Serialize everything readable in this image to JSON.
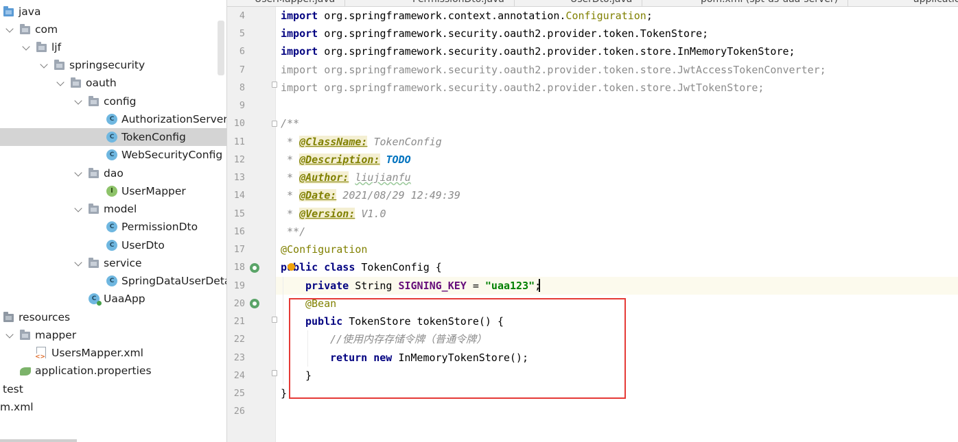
{
  "tabs": [
    "UserMapper.java",
    "PermissionDto.java",
    "UserDto.java",
    "pom.xml (spt-ds-uaa-server)",
    "application"
  ],
  "tree": [
    {
      "label": "java",
      "icon": "folder-blue-icon",
      "depth": 0
    },
    {
      "label": "com",
      "icon": "package-icon",
      "depth": 1
    },
    {
      "label": "ljf",
      "icon": "package-icon",
      "depth": 2
    },
    {
      "label": "springsecurity",
      "icon": "package-icon",
      "depth": 3
    },
    {
      "label": "oauth",
      "icon": "package-icon",
      "depth": 4
    },
    {
      "label": "config",
      "icon": "package-icon",
      "depth": 5
    },
    {
      "label": "AuthorizationServer",
      "icon": "class-icon",
      "depth": 6
    },
    {
      "label": "TokenConfig",
      "icon": "class-icon",
      "depth": 6,
      "selected": true
    },
    {
      "label": "WebSecurityConfig",
      "icon": "class-icon",
      "depth": 6
    },
    {
      "label": "dao",
      "icon": "package-icon",
      "depth": 5
    },
    {
      "label": "UserMapper",
      "icon": "interface-icon",
      "depth": 6
    },
    {
      "label": "model",
      "icon": "package-icon",
      "depth": 5
    },
    {
      "label": "PermissionDto",
      "icon": "class-icon",
      "depth": 6
    },
    {
      "label": "UserDto",
      "icon": "class-icon",
      "depth": 6
    },
    {
      "label": "service",
      "icon": "package-icon",
      "depth": 5
    },
    {
      "label": "SpringDataUserDetai",
      "icon": "class-icon",
      "depth": 6
    },
    {
      "label": "UaaApp",
      "icon": "spring-app-icon",
      "depth": 5
    },
    {
      "label": "resources",
      "icon": "resources-folder-icon",
      "depth": 0
    },
    {
      "label": "mapper",
      "icon": "package-icon",
      "depth": 1
    },
    {
      "label": "UsersMapper.xml",
      "icon": "xml-file-icon",
      "depth": 2
    },
    {
      "label": "application.properties",
      "icon": "spring-properties-icon",
      "depth": 1
    },
    {
      "label": "test",
      "icon": "none",
      "depth": 0
    },
    {
      "label": "m.xml",
      "icon": "none",
      "depth": 0
    }
  ],
  "editor": {
    "line_numbers": [
      "4",
      "5",
      "6",
      "7",
      "8",
      "9",
      "10",
      "11",
      "12",
      "13",
      "14",
      "15",
      "16",
      "17",
      "18",
      "19",
      "20",
      "21",
      "22",
      "23",
      "24",
      "25",
      "26"
    ],
    "import4_kw": "import",
    "import4_pkg": " org.springframework.context.annotation.",
    "import4_cls": "Configuration",
    "import4_end": ";",
    "import5_kw": "import",
    "import5_rest": " org.springframework.security.oauth2.provider.token.TokenStore;",
    "import6_kw": "import",
    "import6_rest": " org.springframework.security.oauth2.provider.token.store.InMemoryTokenStore;",
    "import7": "import org.springframework.security.oauth2.provider.token.store.JwtAccessTokenConverter;",
    "import8": "import org.springframework.security.oauth2.provider.token.store.JwtTokenStore;",
    "doc_open": "/**",
    "doc_star": " * ",
    "doc_close": " **/",
    "tag_classname": "@ClassName:",
    "val_classname": " TokenConfig",
    "tag_description": "@Description:",
    "val_description": "TODO",
    "tag_author": "@Author:",
    "val_author": "liujianfu",
    "tag_date": "@Date:",
    "val_date": " 2021/08/29 12:49:39",
    "tag_version": "@Version:",
    "val_version": " V1.0",
    "annotation_configuration": "@Configuration",
    "class_kw": "public class",
    "class_name": " TokenConfig {",
    "field_kw1": "private",
    "field_type": " String ",
    "field_name": "SIGNING_KEY",
    "field_eq": " = ",
    "field_value": "\"uaa123\"",
    "field_end": ";",
    "annotation_bean": "@Bean",
    "method_kw": "public",
    "method_sig": " TokenStore tokenStore() {",
    "method_comment": "//使用内存存储令牌（普通令牌）",
    "return_kw": "return",
    "new_kw": " new",
    "return_rest": " InMemoryTokenStore();",
    "method_close": "}",
    "class_close": "}"
  }
}
